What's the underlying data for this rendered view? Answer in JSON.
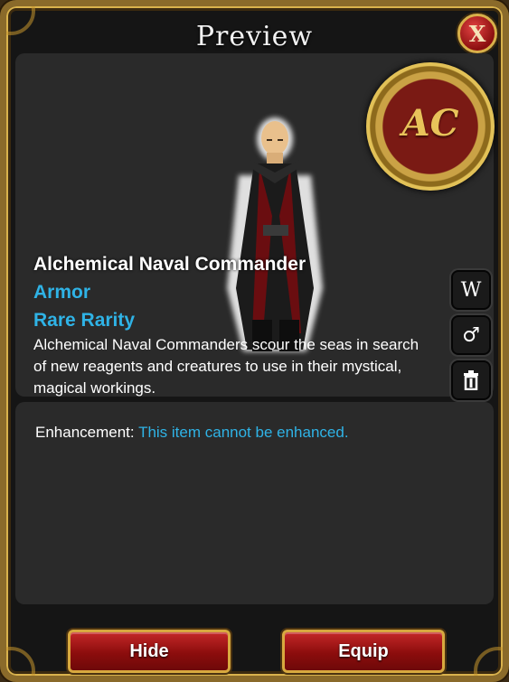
{
  "window": {
    "title": "Preview",
    "close_icon": "close-icon"
  },
  "logo": {
    "monogram": "AC"
  },
  "item": {
    "name": "Alchemical Naval Commander",
    "type": "Armor",
    "rarity": "Rare Rarity",
    "description": "Alchemical Naval Commanders scour the seas in search of new reagents and creatures to use in their mystical, magical workings."
  },
  "side_buttons": [
    {
      "name": "wear-button",
      "glyph": "W",
      "icon": "wear-icon"
    },
    {
      "name": "gender-button",
      "glyph": "♂",
      "icon": "male-gender-icon"
    },
    {
      "name": "delete-button",
      "glyph": "🗑",
      "icon": "trash-icon"
    }
  ],
  "enhancement": {
    "label": "Enhancement:",
    "value": "This item cannot be enhanced."
  },
  "buttons": {
    "hide": "Hide",
    "equip": "Equip"
  },
  "colors": {
    "accent_blue": "#2fb3e6",
    "frame_gold": "#d9b24d",
    "button_red": "#a81616"
  }
}
